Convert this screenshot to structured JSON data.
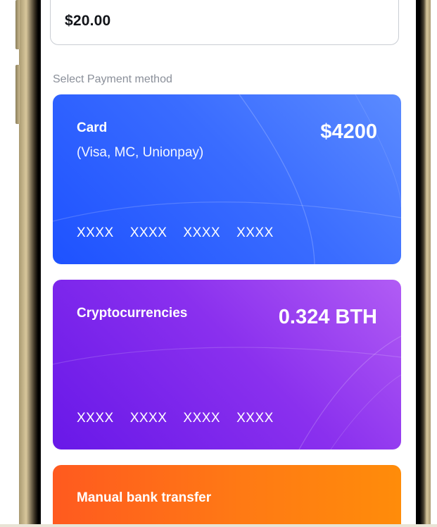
{
  "amount": {
    "value": "$20.00"
  },
  "payment": {
    "section_label": "Select Payment method",
    "methods": [
      {
        "title": "Card",
        "subtitle": "(Visa, MC, Unionpay)",
        "balance": "$4200",
        "number_groups": [
          "XXXX",
          "XXXX",
          "XXXX",
          "XXXX"
        ],
        "gradient": [
          "#5b8bff",
          "#1e52ff"
        ]
      },
      {
        "title": "Cryptocurrencies",
        "balance": "0.324 BTH",
        "number_groups": [
          "XXXX",
          "XXXX",
          "XXXX",
          "XXXX"
        ],
        "gradient": [
          "#b15cf4",
          "#6818e8"
        ]
      },
      {
        "title": "Manual bank transfer",
        "gradient": [
          "#ff5a1f",
          "#ff8c0a"
        ]
      }
    ]
  },
  "colors": {
    "text_primary": "#111318",
    "text_muted": "#8a8f99",
    "border": "#c9cdd3"
  }
}
